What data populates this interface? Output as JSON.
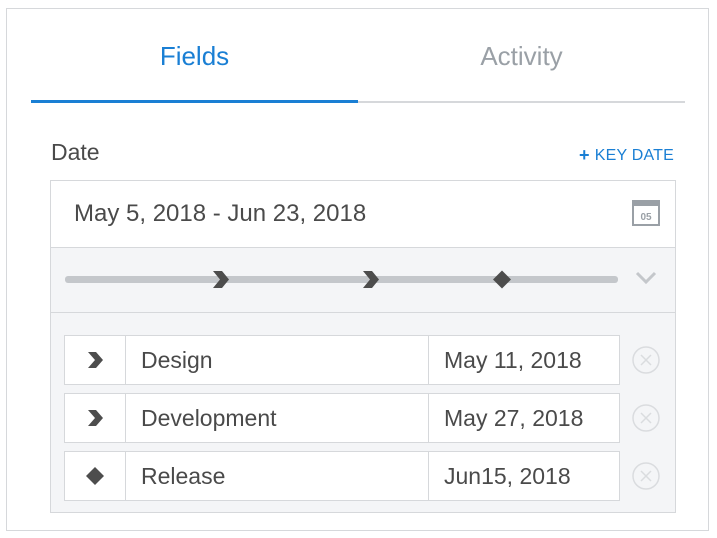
{
  "tabs": [
    {
      "label": "Fields",
      "active": true
    },
    {
      "label": "Activity",
      "active": false
    }
  ],
  "section": {
    "label": "Date",
    "key_date_plus": "+",
    "key_date_label": "KEY DATE"
  },
  "date_field": {
    "value": "May 5, 2018 - Jun 23, 2018",
    "calendar_icon_text": "05"
  },
  "milestones": [
    {
      "icon": "chevron-right-icon",
      "name": "Design",
      "date": "May 11, 2018"
    },
    {
      "icon": "chevron-right-icon",
      "name": "Development",
      "date": "May 27, 2018"
    },
    {
      "icon": "diamond-icon",
      "name": "Release",
      "date": "Jun15, 2018"
    }
  ],
  "colors": {
    "accent": "#1a7fd4",
    "text": "#4a4a4a",
    "muted": "#9aa0a6",
    "border": "#d6d8db",
    "marker": "#4d4d4d"
  }
}
